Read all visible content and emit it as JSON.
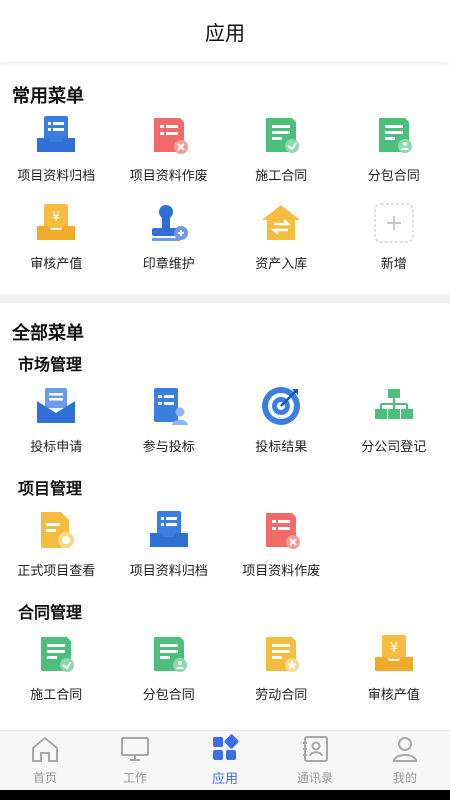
{
  "header": {
    "title": "应用"
  },
  "common": {
    "title": "常用菜单",
    "items": [
      {
        "label": "项目资料归档",
        "icon": "archive-tray-icon"
      },
      {
        "label": "项目资料作废",
        "icon": "void-document-icon"
      },
      {
        "label": "施工合同",
        "icon": "construction-contract-icon"
      },
      {
        "label": "分包合同",
        "icon": "subcontract-icon"
      },
      {
        "label": "审核产值",
        "icon": "output-value-icon"
      },
      {
        "label": "印章维护",
        "icon": "seal-icon"
      },
      {
        "label": "资产入库",
        "icon": "asset-storage-icon"
      },
      {
        "label": "新增",
        "icon": "add-icon"
      }
    ]
  },
  "all": {
    "title": "全部菜单",
    "groups": [
      {
        "title": "市场管理",
        "items": [
          {
            "label": "投标申请",
            "icon": "bid-application-icon"
          },
          {
            "label": "参与投标",
            "icon": "join-bid-icon"
          },
          {
            "label": "投标结果",
            "icon": "target-icon"
          },
          {
            "label": "分公司登记",
            "icon": "org-chart-icon"
          }
        ]
      },
      {
        "title": "项目管理",
        "items": [
          {
            "label": "正式项目查看",
            "icon": "project-view-icon"
          },
          {
            "label": "项目资料归档",
            "icon": "archive-tray-icon"
          },
          {
            "label": "项目资料作废",
            "icon": "void-document-icon"
          }
        ]
      },
      {
        "title": "合同管理",
        "items": [
          {
            "label": "施工合同",
            "icon": "construction-contract-icon"
          },
          {
            "label": "分包合同",
            "icon": "subcontract-icon"
          },
          {
            "label": "劳动合同",
            "icon": "labor-contract-icon"
          },
          {
            "label": "审核产值",
            "icon": "output-value-icon"
          }
        ]
      }
    ]
  },
  "tabbar": [
    {
      "label": "首页",
      "icon": "home-icon",
      "active": false
    },
    {
      "label": "工作",
      "icon": "monitor-icon",
      "active": false
    },
    {
      "label": "应用",
      "icon": "apps-icon",
      "active": true
    },
    {
      "label": "通讯录",
      "icon": "contacts-icon",
      "active": false
    },
    {
      "label": "我的",
      "icon": "user-icon",
      "active": false
    }
  ],
  "colors": {
    "accent": "#3d6ee8",
    "green": "#4cbf7d",
    "red": "#f06a6a",
    "yellow": "#f5bd3f",
    "blue": "#3a7fe0"
  }
}
